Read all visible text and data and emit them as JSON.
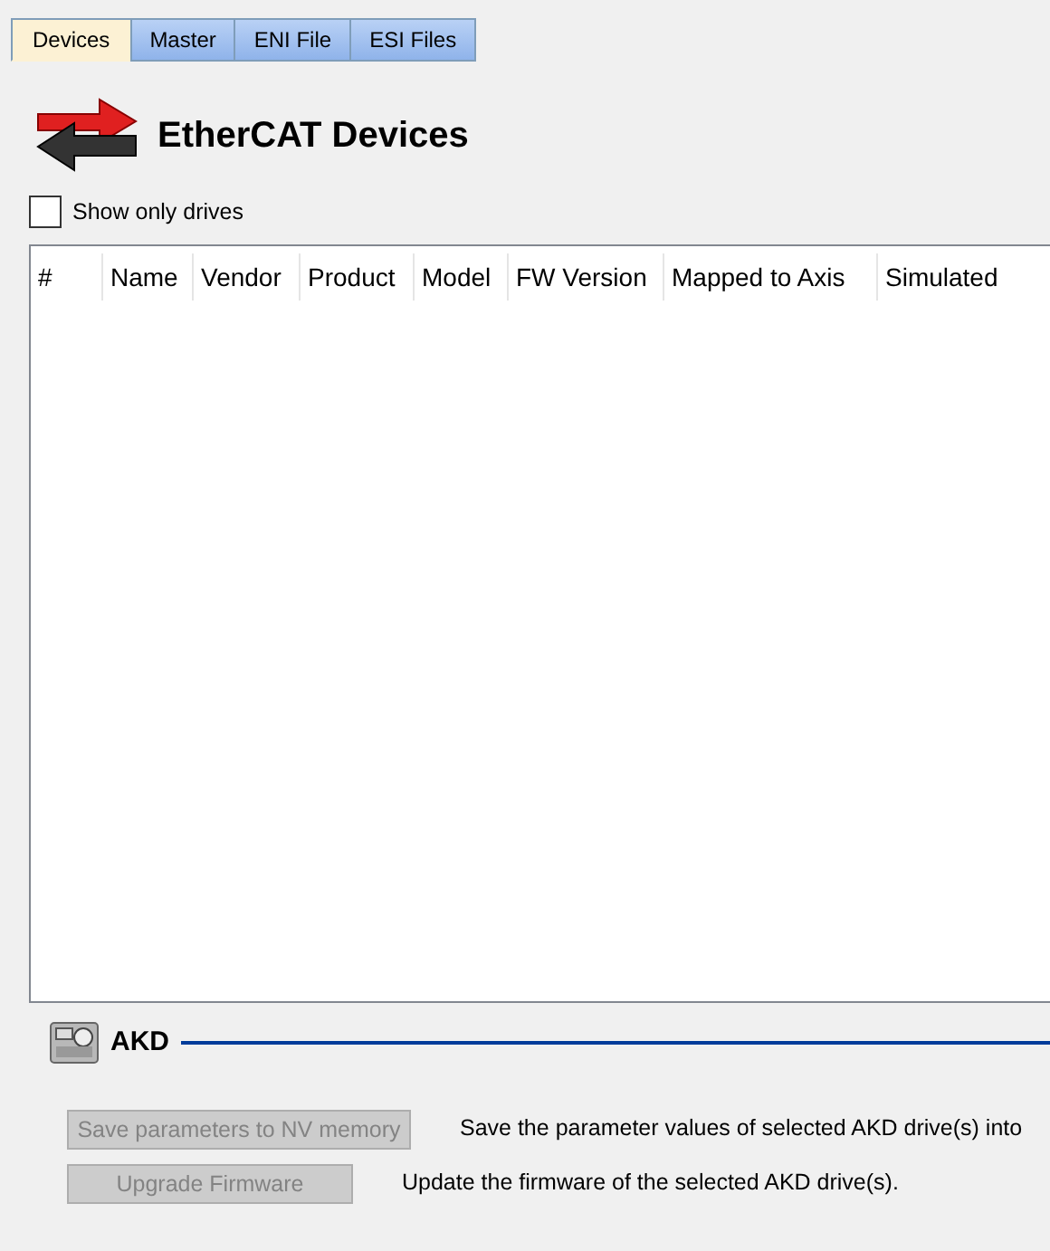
{
  "tabs": [
    {
      "label": "Devices",
      "selected": true
    },
    {
      "label": "Master",
      "selected": false
    },
    {
      "label": "ENI File",
      "selected": false
    },
    {
      "label": "ESI Files",
      "selected": false
    }
  ],
  "title": "EtherCAT Devices",
  "show_only_drives": {
    "label": "Show only drives",
    "checked": false
  },
  "table": {
    "columns": [
      "#",
      "Name",
      "Vendor",
      "Product",
      "Model",
      "FW Version",
      "Mapped to Axis",
      "Simulated"
    ]
  },
  "section": {
    "title": "AKD"
  },
  "actions": [
    {
      "button": "Save parameters to NV memory",
      "disabled": true,
      "description": "Save the parameter values of selected AKD drive(s) into"
    },
    {
      "button": "Upgrade Firmware",
      "disabled": true,
      "description": "Update the firmware of the selected AKD drive(s)."
    }
  ]
}
